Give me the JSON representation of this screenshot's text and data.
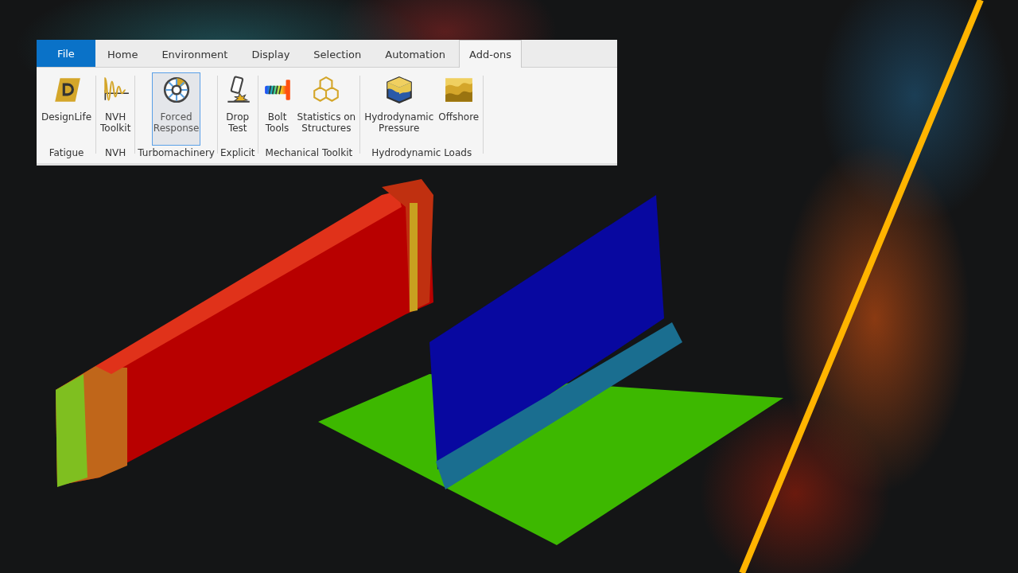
{
  "ribbon": {
    "tabs": [
      {
        "label": "File",
        "kind": "file",
        "selected": false
      },
      {
        "label": "Home",
        "kind": "tab",
        "selected": false
      },
      {
        "label": "Environment",
        "kind": "tab",
        "selected": false
      },
      {
        "label": "Display",
        "kind": "tab",
        "selected": false
      },
      {
        "label": "Selection",
        "kind": "tab",
        "selected": false
      },
      {
        "label": "Automation",
        "kind": "tab",
        "selected": false
      },
      {
        "label": "Add-ons",
        "kind": "tab",
        "selected": true
      }
    ],
    "groups": [
      {
        "label": "Fatigue",
        "buttons": [
          {
            "label": "DesignLife",
            "kind": "designlife",
            "selected": false
          }
        ]
      },
      {
        "label": "NVH",
        "buttons": [
          {
            "label": "NVH\nToolkit",
            "kind": "nvh",
            "selected": false
          }
        ]
      },
      {
        "label": "Turbomachinery",
        "buttons": [
          {
            "label": "Forced\nResponse",
            "kind": "wheel",
            "selected": true
          }
        ]
      },
      {
        "label": "Explicit",
        "buttons": [
          {
            "label": "Drop\nTest",
            "kind": "drop",
            "selected": false
          }
        ]
      },
      {
        "label": "Mechanical Toolkit",
        "buttons": [
          {
            "label": "Bolt\nTools",
            "kind": "bolt",
            "selected": false
          },
          {
            "label": "Statistics on\nStructures",
            "kind": "cubes",
            "selected": false
          }
        ]
      },
      {
        "label": "Hydrodynamic Loads",
        "buttons": [
          {
            "label": "Hydrodynamic\nPressure",
            "kind": "box",
            "selected": false
          },
          {
            "label": "Offshore",
            "kind": "waves",
            "selected": false
          }
        ]
      }
    ]
  }
}
